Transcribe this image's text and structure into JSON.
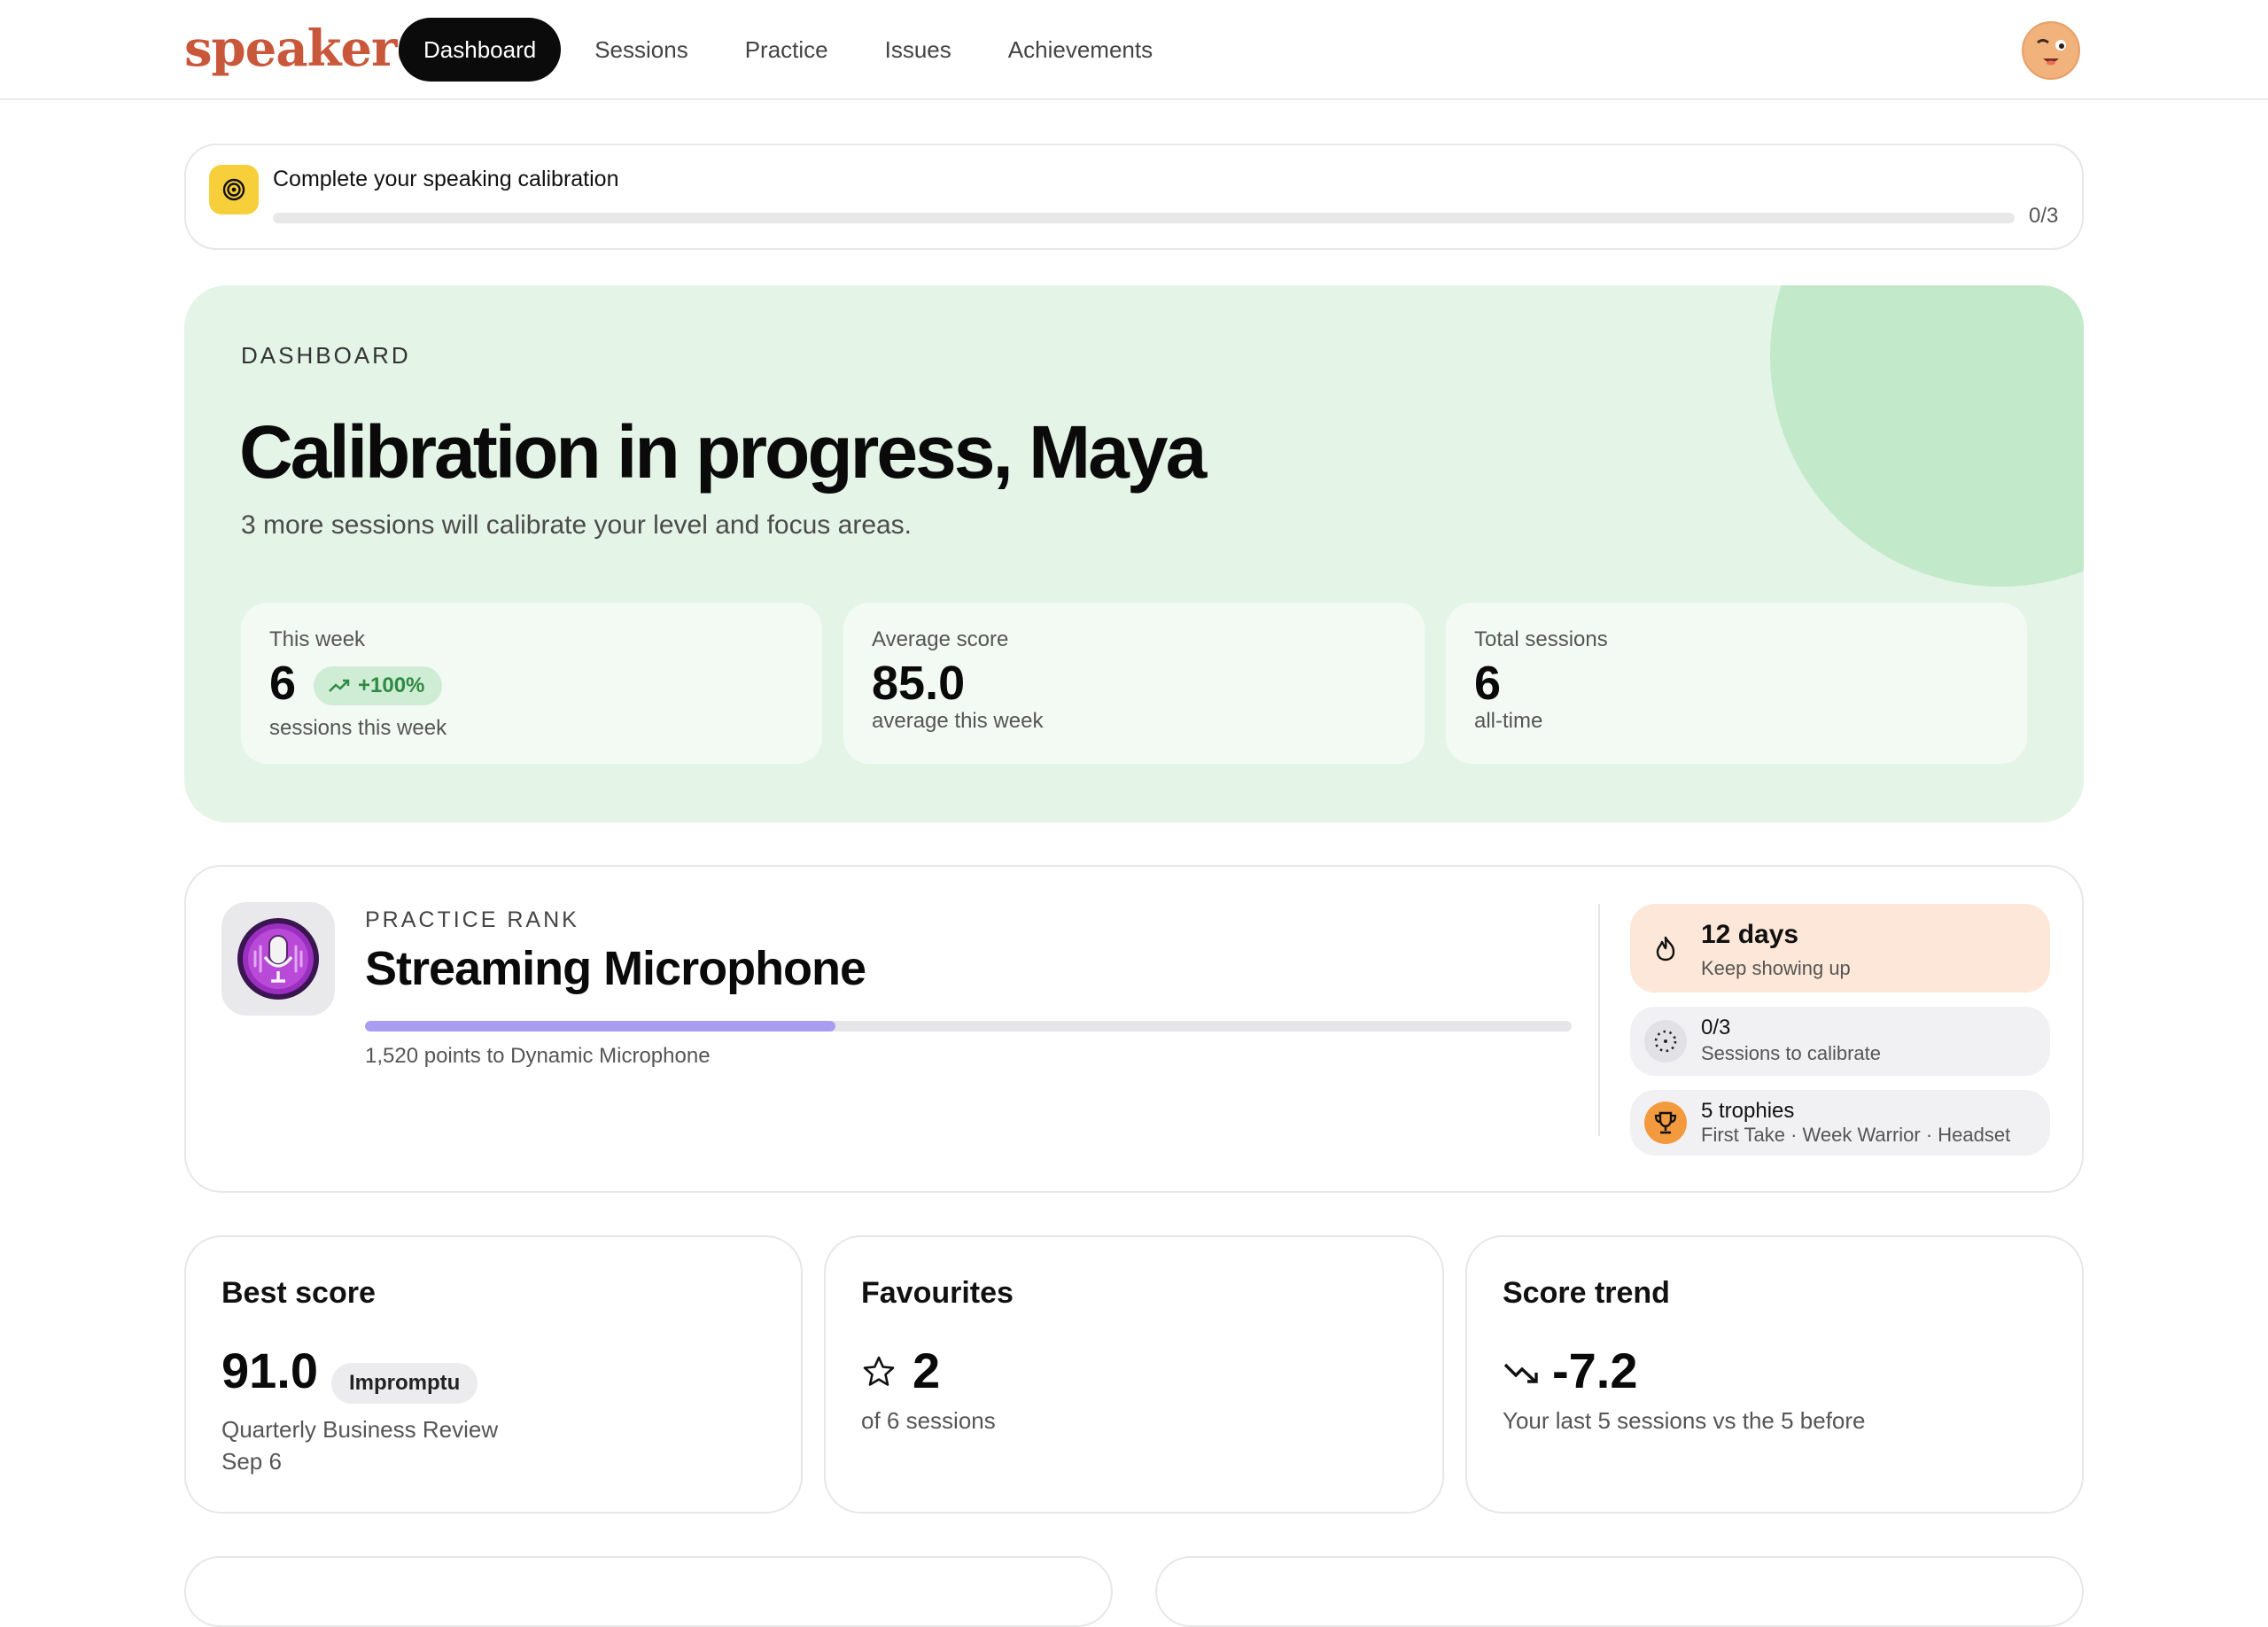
{
  "app": {
    "logo_text": "speakeroo",
    "brand_color": "#c9583a"
  },
  "nav": {
    "items": [
      {
        "label": "Dashboard",
        "active": true
      },
      {
        "label": "Sessions",
        "active": false
      },
      {
        "label": "Practice",
        "active": false
      },
      {
        "label": "Issues",
        "active": false
      },
      {
        "label": "Achievements",
        "active": false
      }
    ]
  },
  "calibration": {
    "title": "Complete your speaking calibration",
    "count": "0/3",
    "progress": 0,
    "icon": "target-icon"
  },
  "hero": {
    "eyebrow": "DASHBOARD",
    "title": "Calibration in progress, Maya",
    "subtitle": "3 more sessions will calibrate your level and focus areas.",
    "stats": [
      {
        "label": "This week",
        "value": "6",
        "trend": "+100%",
        "note": "sessions this week"
      },
      {
        "label": "Average score",
        "value": "85.0",
        "note": "average this week"
      },
      {
        "label": "Total sessions",
        "value": "6",
        "note": "all-time"
      }
    ]
  },
  "rank": {
    "eyebrow": "PRACTICE RANK",
    "title": "Streaming Microphone",
    "progress": 0.39,
    "note": "1,520 points to Dynamic Microphone",
    "badge_icon": "microphone-icon",
    "streak": {
      "main": "12 days",
      "sub": "Keep showing up",
      "icon": "flame-icon"
    },
    "calibrate": {
      "main": "0/3",
      "sub": "Sessions to calibrate",
      "icon": "dotted-circle-icon"
    },
    "trophies": {
      "main": "5 trophies",
      "sub": "First Take · Week Warrior · Headset",
      "icon": "trophy-icon"
    }
  },
  "cards": {
    "best": {
      "title": "Best score",
      "value": "91.0",
      "pill": "Impromptu",
      "line1": "Quarterly Business Review",
      "line2": "Sep 6"
    },
    "favourites": {
      "title": "Favourites",
      "value": "2",
      "note": "of 6 sessions",
      "icon": "star-icon"
    },
    "trend": {
      "title": "Score trend",
      "value": "-7.2",
      "note": "Your last 5 sessions vs the 5 before",
      "icon": "trend-down-icon"
    }
  }
}
